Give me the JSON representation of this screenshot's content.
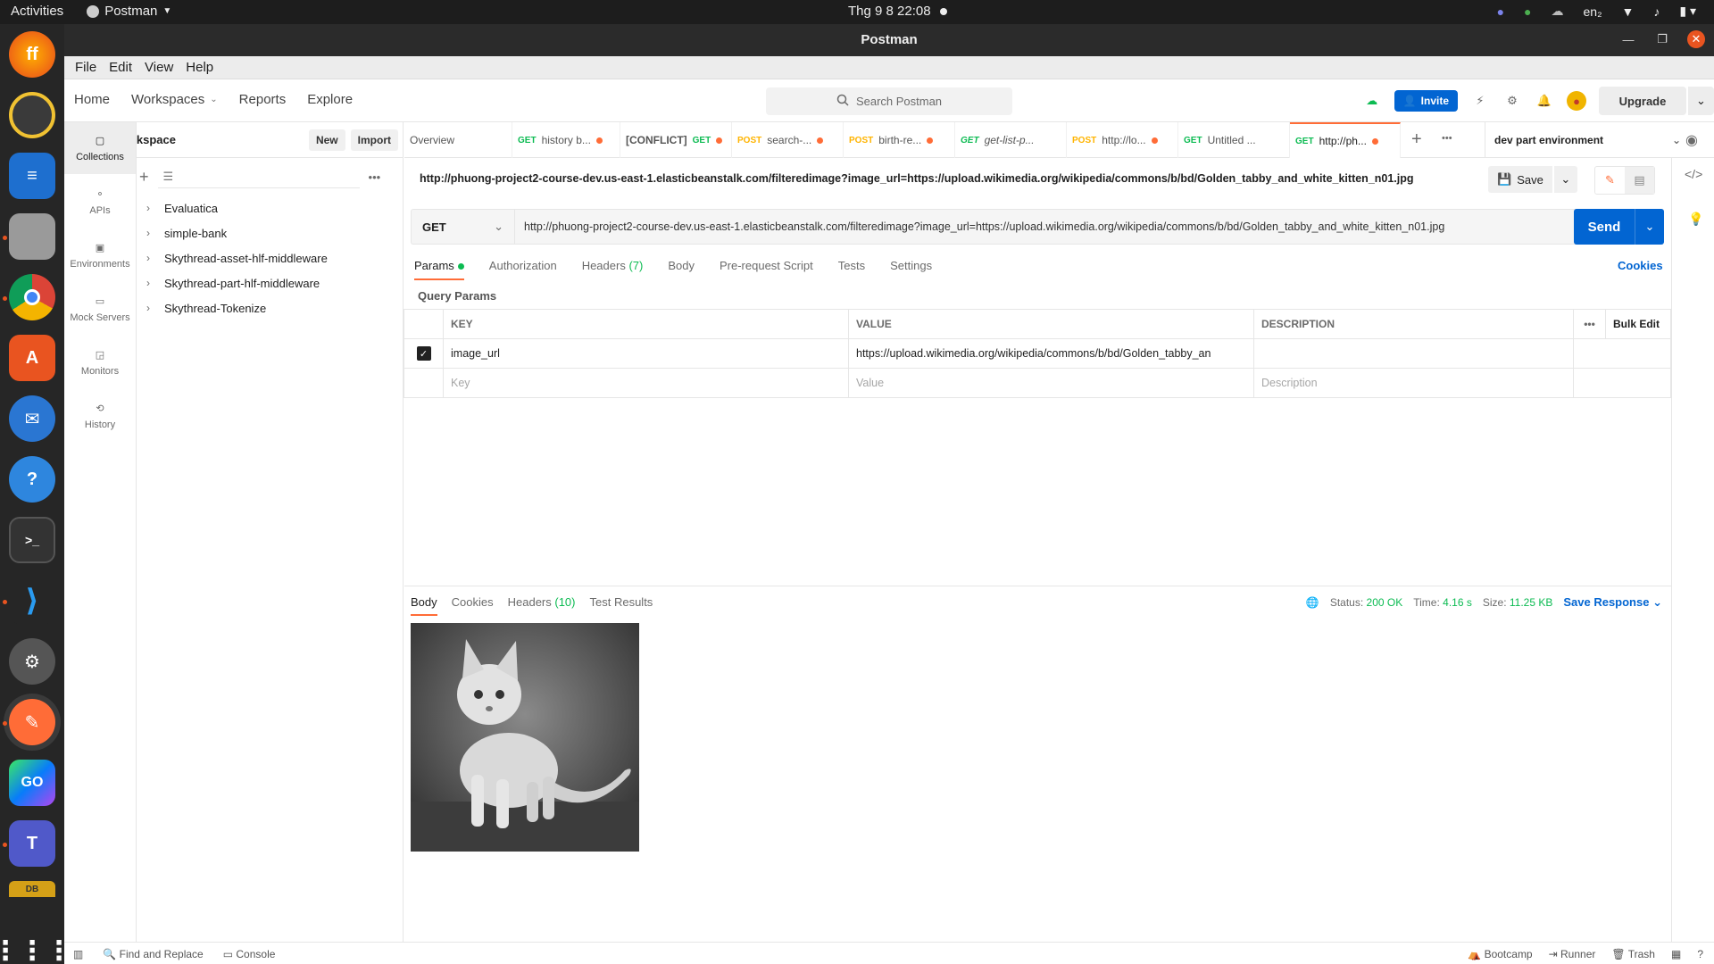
{
  "system": {
    "activities": "Activities",
    "app_name": "Postman",
    "clock": "Thg 9 8  22:08",
    "lang": "en₂"
  },
  "window": {
    "title": "Postman"
  },
  "menu": [
    "File",
    "Edit",
    "View",
    "Help"
  ],
  "header": {
    "nav": [
      "Home",
      "Workspaces",
      "Reports",
      "Explore"
    ],
    "search_placeholder": "Search Postman",
    "invite": "Invite",
    "upgrade": "Upgrade"
  },
  "rail": [
    "Collections",
    "APIs",
    "Environments",
    "Mock Servers",
    "Monitors",
    "History"
  ],
  "workspace": {
    "name": "My Workspace",
    "new": "New",
    "import": "Import"
  },
  "collections": [
    "Evaluatica",
    "simple-bank",
    "Skythread-asset-hlf-middleware",
    "Skythread-part-hlf-middleware",
    "Skythread-Tokenize"
  ],
  "tabs": [
    {
      "method": "",
      "label": "Overview"
    },
    {
      "method": "GET",
      "label": "history b..."
    },
    {
      "method": "GET",
      "label": "[CONFLICT]",
      "conflict": true
    },
    {
      "method": "POST",
      "label": "search-..."
    },
    {
      "method": "POST",
      "label": "birth-re..."
    },
    {
      "method": "GET",
      "label": "get-list-p..."
    },
    {
      "method": "POST",
      "label": "http://lo..."
    },
    {
      "method": "GET",
      "label": "Untitled ..."
    },
    {
      "method": "GET",
      "label": "http://ph..."
    }
  ],
  "environment": "dev part environment",
  "request": {
    "title": "http://phuong-project2-course-dev.us-east-1.elasticbeanstalk.com/filteredimage?image_url=https://upload.wikimedia.org/wikipedia/commons/b/bd/Golden_tabby_and_white_kitten_n01.jpg",
    "save": "Save",
    "method": "GET",
    "url": "http://phuong-project2-course-dev.us-east-1.elasticbeanstalk.com/filteredimage?image_url=https://upload.wikimedia.org/wikipedia/commons/b/bd/Golden_tabby_and_white_kitten_n01.jpg",
    "send": "Send",
    "tabs": {
      "params": "Params",
      "authorization": "Authorization",
      "headers": "Headers",
      "headers_count": "(7)",
      "body": "Body",
      "pre_request": "Pre-request Script",
      "tests": "Tests",
      "settings": "Settings"
    },
    "cookies": "Cookies",
    "query_params_title": "Query Params",
    "table_headers": {
      "key": "KEY",
      "value": "VALUE",
      "description": "DESCRIPTION",
      "bulk_edit": "Bulk Edit"
    },
    "param_row": {
      "key": "image_url",
      "value": "https://upload.wikimedia.org/wikipedia/commons/b/bd/Golden_tabby_an"
    },
    "placeholders": {
      "key": "Key",
      "value": "Value",
      "description": "Description"
    }
  },
  "response": {
    "tabs": {
      "body": "Body",
      "cookies": "Cookies",
      "headers": "Headers",
      "headers_count": "(10)",
      "test_results": "Test Results"
    },
    "status_label": "Status:",
    "status": "200 OK",
    "time_label": "Time:",
    "time": "4.16 s",
    "size_label": "Size:",
    "size": "11.25 KB",
    "save_response": "Save Response"
  },
  "statusbar": {
    "find_replace": "Find and Replace",
    "console": "Console",
    "bootcamp": "Bootcamp",
    "runner": "Runner",
    "trash": "Trash"
  },
  "colors": {
    "accent": "#ff6c37",
    "primary": "#0265d2",
    "success": "#0cbb52"
  }
}
